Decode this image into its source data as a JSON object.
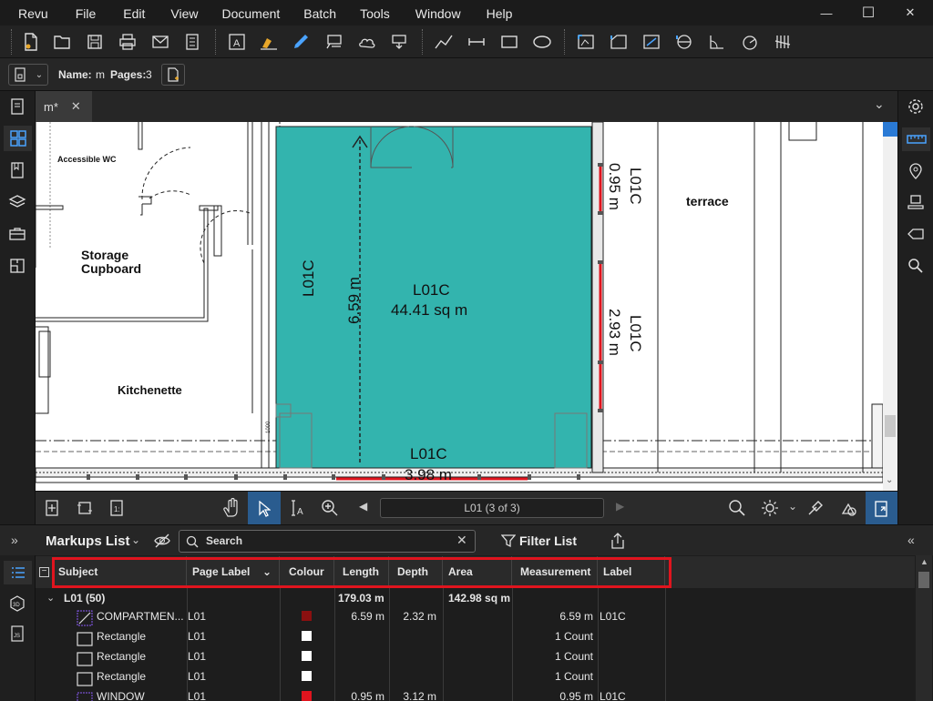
{
  "menu": [
    "Revu",
    "File",
    "Edit",
    "View",
    "Document",
    "Batch",
    "Tools",
    "Window",
    "Help"
  ],
  "window_controls": {
    "minimize": "—",
    "maximize": "☐",
    "close": "✕"
  },
  "toolbar_icons": [
    "new-file-icon",
    "open-folder-icon",
    "save-icon",
    "print-icon",
    "email-icon",
    "markup-list-icon",
    "text-box-icon",
    "highlighter-icon",
    "pen-icon",
    "callout-icon",
    "cloud-icon",
    "arrow-callout-icon",
    "polyline-icon",
    "dimension-icon",
    "rectangle-icon",
    "ellipse-icon",
    "area-measure-icon",
    "perimeter-icon",
    "volume-icon",
    "diameter-icon",
    "angle-icon",
    "radius-icon",
    "count-icon"
  ],
  "properties": {
    "name_label": "Name:",
    "name_value": "m",
    "pages_label": "Pages:",
    "pages_value": "3"
  },
  "tab": {
    "title": "m*",
    "close": "✕",
    "overflow": "⌄"
  },
  "drawing": {
    "room_labels": [
      "Accessible WC",
      "Storage",
      "Cupboard",
      "Kitchenette",
      "terrace"
    ],
    "area_name": "L01C",
    "area_value": "44.41 sq m",
    "length_name": "L01C",
    "length_value": "6.59 m",
    "right_top_name": "L01C",
    "right_top_value": "0.95 m",
    "right_mid_name": "L01C",
    "right_mid_value": "2.93 m",
    "bottom_name": "L01C",
    "bottom_value": "3.98 m",
    "small_label": "1000"
  },
  "colors": {
    "area_fill": "#33b4ae",
    "markup_red": "#e0141e",
    "accent_blue": "#2a7ad5"
  },
  "navbar": {
    "page_field": "L01 (3 of 3)"
  },
  "markups": {
    "title": "Markups List",
    "search_placeholder": "Search",
    "filter_label": "Filter List",
    "columns": [
      "Subject",
      "Page Label",
      "Colour",
      "Length",
      "Depth",
      "Area",
      "Measurement",
      "Label"
    ],
    "group": {
      "name": "L01 (50)",
      "length": "179.03 m",
      "area": "142.98 sq m"
    },
    "rows": [
      {
        "subject": "COMPARTMEN...",
        "page": "L01",
        "colour": "#8b1010",
        "length": "6.59 m",
        "depth": "2.32 m",
        "area": "",
        "measurement": "6.59 m",
        "label": "L01C"
      },
      {
        "subject": "Rectangle",
        "page": "L01",
        "colour": "#ffffff",
        "length": "",
        "depth": "",
        "area": "",
        "measurement": "1 Count",
        "label": ""
      },
      {
        "subject": "Rectangle",
        "page": "L01",
        "colour": "#ffffff",
        "length": "",
        "depth": "",
        "area": "",
        "measurement": "1 Count",
        "label": ""
      },
      {
        "subject": "Rectangle",
        "page": "L01",
        "colour": "#ffffff",
        "length": "",
        "depth": "",
        "area": "",
        "measurement": "1 Count",
        "label": ""
      },
      {
        "subject": "WINDOW",
        "page": "L01",
        "colour": "#e0141e",
        "length": "0.95 m",
        "depth": "3.12 m",
        "area": "",
        "measurement": "0.95 m",
        "label": "L01C"
      }
    ]
  }
}
